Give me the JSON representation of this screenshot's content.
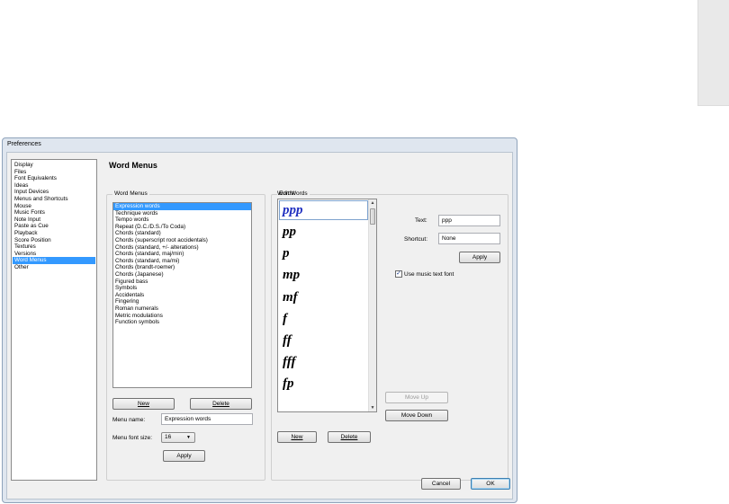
{
  "dialog": {
    "title": "Preferences"
  },
  "nav": {
    "items": [
      {
        "label": "Display"
      },
      {
        "label": "Files"
      },
      {
        "label": "Font Equivalents"
      },
      {
        "label": "Ideas"
      },
      {
        "label": "Input Devices"
      },
      {
        "label": "Menus and Shortcuts"
      },
      {
        "label": "Mouse"
      },
      {
        "label": "Music Fonts"
      },
      {
        "label": "Note Input"
      },
      {
        "label": "Paste as Cue"
      },
      {
        "label": "Playback"
      },
      {
        "label": "Score Position"
      },
      {
        "label": "Textures"
      },
      {
        "label": "Versions"
      },
      {
        "label": "Word Menus",
        "selected": true
      },
      {
        "label": "Other"
      }
    ]
  },
  "page": {
    "title": "Word Menus"
  },
  "word_menus": {
    "group_label": "Word Menus",
    "items": [
      {
        "label": "Expression words",
        "selected": true
      },
      {
        "label": "Technique words"
      },
      {
        "label": "Tempo words"
      },
      {
        "label": "Repeat (D.C./D.S./To Coda)"
      },
      {
        "label": "Chords (standard)"
      },
      {
        "label": "Chords (superscript root accidentals)"
      },
      {
        "label": "Chords (standard, +/- alterations)"
      },
      {
        "label": "Chords (standard, maj/min)"
      },
      {
        "label": "Chords (standard, ma/mi)"
      },
      {
        "label": "Chords (brandt-roemer)"
      },
      {
        "label": "Chords (Japanese)"
      },
      {
        "label": "Figured bass"
      },
      {
        "label": "Symbols"
      },
      {
        "label": "Accidentals"
      },
      {
        "label": "Fingering"
      },
      {
        "label": "Roman numerals"
      },
      {
        "label": "Metric modulations"
      },
      {
        "label": "Function symbols"
      }
    ],
    "new_label": "New",
    "delete_label": "Delete",
    "menu_name_label": "Menu name:",
    "menu_name_value": "Expression words",
    "font_size_label": "Menu font size:",
    "font_size_value": "16",
    "apply_label": "Apply"
  },
  "edit_words": {
    "group_label": "Edit Words",
    "words_label": "Words:",
    "words": [
      {
        "text": "ppp",
        "selected": true
      },
      {
        "text": "pp"
      },
      {
        "text": "p"
      },
      {
        "text": "mp"
      },
      {
        "text": "mf"
      },
      {
        "text": "f"
      },
      {
        "text": "ff"
      },
      {
        "text": "fff"
      },
      {
        "text": "fp"
      }
    ],
    "text_label": "Text:",
    "text_value": "ppp",
    "shortcut_label": "Shortcut:",
    "shortcut_value": "None",
    "apply_label": "Apply",
    "use_music_font_label": "Use music text font",
    "use_music_font_checked": true,
    "move_up_label": "Move Up",
    "move_down_label": "Move Down",
    "new_label": "New",
    "delete_label": "Delete"
  },
  "footer": {
    "cancel_label": "Cancel",
    "ok_label": "OK"
  }
}
